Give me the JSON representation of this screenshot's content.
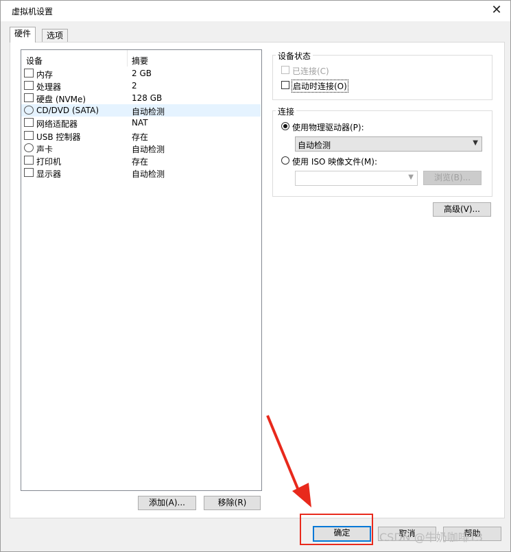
{
  "window": {
    "title": "虚拟机设置",
    "close_glyph": "✕"
  },
  "tabs": [
    {
      "label": "硬件",
      "active": true
    },
    {
      "label": "选项",
      "active": false
    }
  ],
  "device_list": {
    "columns": [
      "设备",
      "摘要"
    ],
    "rows": [
      {
        "name": "内存",
        "summary": "2 GB",
        "icon": "memory-icon"
      },
      {
        "name": "处理器",
        "summary": "2",
        "icon": "cpu-icon"
      },
      {
        "name": "硬盘 (NVMe)",
        "summary": "128 GB",
        "icon": "hard-disk-icon"
      },
      {
        "name": "CD/DVD (SATA)",
        "summary": "自动检测",
        "icon": "cd-dvd-icon",
        "selected": true
      },
      {
        "name": "网络适配器",
        "summary": "NAT",
        "icon": "network-adapter-icon"
      },
      {
        "name": "USB 控制器",
        "summary": "存在",
        "icon": "usb-icon"
      },
      {
        "name": "声卡",
        "summary": "自动检测",
        "icon": "speaker-icon"
      },
      {
        "name": "打印机",
        "summary": "存在",
        "icon": "printer-icon"
      },
      {
        "name": "显示器",
        "summary": "自动检测",
        "icon": "monitor-icon"
      }
    ]
  },
  "buttons": {
    "add": "添加(A)...",
    "remove": "移除(R)",
    "advanced": "高级(V)...",
    "ok": "确定",
    "cancel": "取消",
    "help": "帮助",
    "browse": "浏览(B)..."
  },
  "device_status": {
    "group_label": "设备状态",
    "connected_label": "已连接(C)",
    "connect_on_power_on_label": "启动时连接(O)"
  },
  "connection": {
    "group_label": "连接",
    "physical_drive_label": "使用物理驱动器(P):",
    "physical_drive_value": "自动检测",
    "iso_label": "使用 ISO 映像文件(M):",
    "iso_value": ""
  },
  "watermark": "CSDN @牛奶咖啡13",
  "colors": {
    "highlight": "#e8291c",
    "selection": "#e5f3ff"
  }
}
